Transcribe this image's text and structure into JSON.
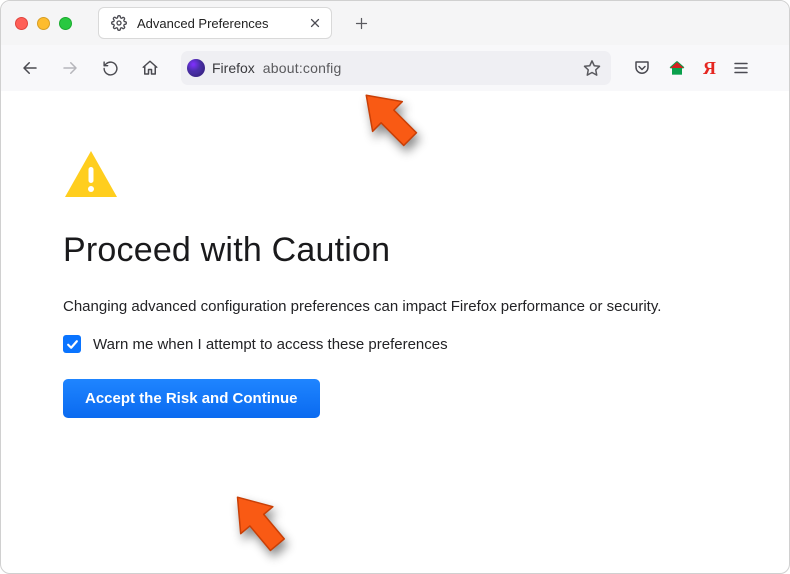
{
  "window": {
    "tab_label": "Advanced Preferences"
  },
  "urlbar": {
    "brand": "Firefox",
    "url": "about:config"
  },
  "page": {
    "heading": "Proceed with Caution",
    "description": "Changing advanced configuration preferences can impact Firefox performance or security.",
    "checkbox_label": "Warn me when I attempt to access these preferences",
    "accept_button": "Accept the Risk and Continue",
    "checkbox_checked": true
  },
  "icons": {
    "gear": "gear-icon",
    "close": "close-icon",
    "plus": "plus-icon",
    "back": "chevron-left-icon",
    "forward": "chevron-right-icon",
    "reload": "reload-icon",
    "home": "home-icon",
    "star": "star-icon",
    "pocket": "pocket-icon",
    "house_ext": "home-extension-icon",
    "yandex": "yandex-icon",
    "menu": "hamburger-icon",
    "warn": "warning-icon",
    "arrow": "annotation-arrow"
  },
  "colors": {
    "accent": "#0a74ff",
    "warn": "#ffce1e",
    "arrow": "#f95a14"
  }
}
